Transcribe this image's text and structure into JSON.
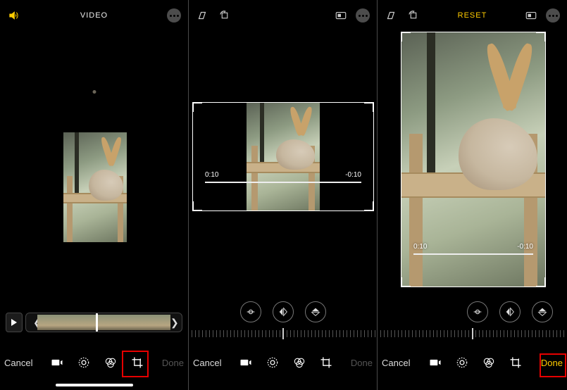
{
  "phone1": {
    "header": {
      "title": "VIDEO",
      "sound_icon": "sound-on-icon",
      "more_icon": "more-icon"
    },
    "playback": {
      "play_label": "play"
    },
    "toolbar": {
      "cancel": "Cancel",
      "done": "Done",
      "video_icon": "video-icon",
      "adjust_icon": "adjust-icon",
      "filters_icon": "filters-icon",
      "crop_icon": "crop-icon"
    }
  },
  "phone2": {
    "header": {
      "skew_icon": "skew-icon",
      "rotate_icon": "rotate-icon",
      "aspect_icon": "aspect-ratio-icon",
      "more_icon": "more-icon"
    },
    "time": {
      "left": "0:10",
      "right": "-0:10"
    },
    "crop_tools": {
      "straighten_icon": "straighten-icon",
      "flip_h_icon": "flip-horizontal-icon",
      "flip_v_icon": "flip-vertical-icon"
    },
    "toolbar": {
      "cancel": "Cancel",
      "done": "Done",
      "video_icon": "video-icon",
      "adjust_icon": "adjust-icon",
      "filters_icon": "filters-icon",
      "crop_icon": "crop-icon"
    }
  },
  "phone3": {
    "header": {
      "skew_icon": "skew-icon",
      "rotate_icon": "rotate-icon",
      "reset_label": "RESET",
      "aspect_icon": "aspect-ratio-icon",
      "more_icon": "more-icon"
    },
    "time": {
      "left": "0:10",
      "right": "-0:10"
    },
    "crop_tools": {
      "straighten_icon": "straighten-icon",
      "flip_h_icon": "flip-horizontal-icon",
      "flip_v_icon": "flip-vertical-icon"
    },
    "toolbar": {
      "cancel": "Cancel",
      "done": "Done",
      "video_icon": "video-icon",
      "adjust_icon": "adjust-icon",
      "filters_icon": "filters-icon",
      "crop_icon": "crop-icon"
    }
  },
  "colors": {
    "accent": "#ffcc00",
    "highlight": "#e60000"
  }
}
